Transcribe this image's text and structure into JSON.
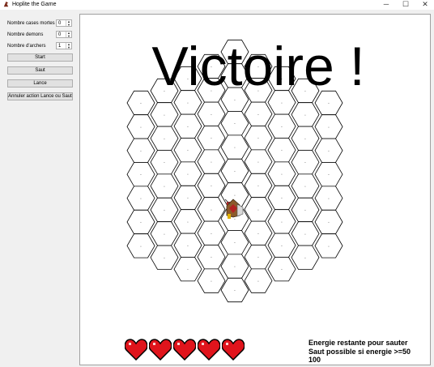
{
  "window": {
    "title": "Hoplite the Game",
    "minimize_glyph": "─",
    "maximize_glyph": "☐",
    "close_glyph": "✕"
  },
  "sidebar": {
    "dead_cells": {
      "label": "Nombre cases mortes",
      "value": "0"
    },
    "demons": {
      "label": "Nombre demons",
      "value": "0"
    },
    "archers": {
      "label": "Nombre d'archers",
      "value": "1"
    },
    "buttons": {
      "start": "Start",
      "jump": "Saut",
      "spear": "Lance",
      "undo": "Annuler action Lance ou Saut"
    }
  },
  "board": {
    "message": "Victoire !",
    "cell_marker": ".",
    "grid_colors": {
      "outline": "#000000",
      "background": "#ffffff"
    },
    "player_icon": "hoplite-player-icon"
  },
  "status": {
    "hearts": 5,
    "heart_color": "#e0141c",
    "energy_title": "Energie restante pour sauter",
    "energy_rule": "Saut possible si energie >=50",
    "energy_value": "100"
  }
}
